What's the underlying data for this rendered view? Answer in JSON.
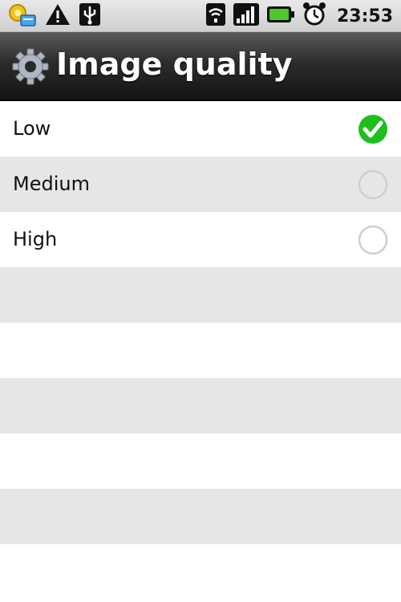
{
  "status_bar": {
    "time": "23:53",
    "icons": [
      "settings-notification-icon",
      "warning-icon",
      "usb-icon",
      "wifi-icon",
      "signal-icon",
      "battery-icon",
      "alarm-icon"
    ]
  },
  "title_bar": {
    "icon": "gear-icon",
    "title": "Image quality"
  },
  "options": [
    {
      "label": "Low",
      "selected": true
    },
    {
      "label": "Medium",
      "selected": false
    },
    {
      "label": "High",
      "selected": false
    }
  ],
  "colors": {
    "selected_green": "#1cbf1c",
    "row_grey": "#e6e6e6"
  }
}
